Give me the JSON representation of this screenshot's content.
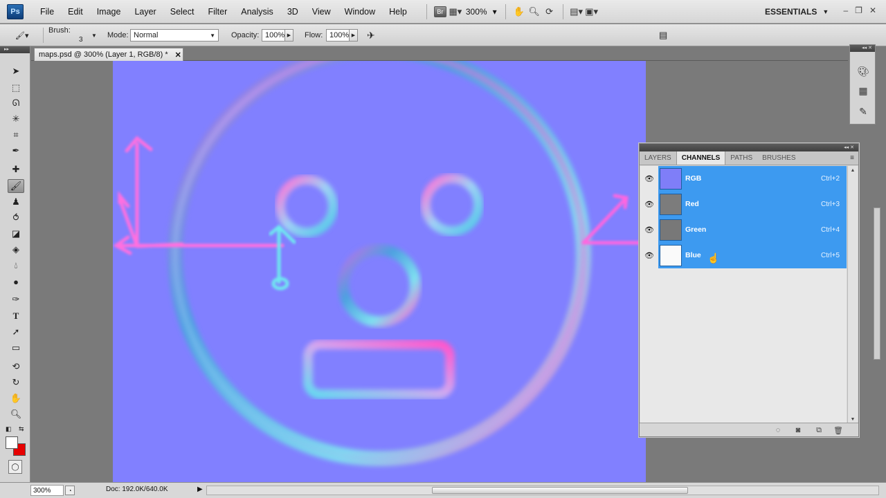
{
  "app": {
    "logo": "Ps"
  },
  "menu": [
    "File",
    "Edit",
    "Image",
    "Layer",
    "Select",
    "Filter",
    "Analysis",
    "3D",
    "View",
    "Window",
    "Help"
  ],
  "menubar_tools": {
    "bridge_label": "Br",
    "zoom_value": "300%"
  },
  "workspace_switcher": {
    "label": "ESSENTIALS"
  },
  "options": {
    "brush_label": "Brush:",
    "brush_size": "3",
    "mode_label": "Mode:",
    "mode_value": "Normal",
    "opacity_label": "Opacity:",
    "opacity_value": "100%",
    "flow_label": "Flow:",
    "flow_value": "100%"
  },
  "document": {
    "tab_title": "maps.psd @ 300% (Layer 1, RGB/8) *",
    "close_glyph": "✕"
  },
  "panel": {
    "tabs": [
      "LAYERS",
      "CHANNELS",
      "PATHS",
      "BRUSHES"
    ],
    "active_tab": "CHANNELS",
    "channels": [
      {
        "name": "RGB",
        "shortcut": "Ctrl+2",
        "thumb_color": "#7f7ef8"
      },
      {
        "name": "Red",
        "shortcut": "Ctrl+3",
        "thumb_color": "#7c7c7c"
      },
      {
        "name": "Green",
        "shortcut": "Ctrl+4",
        "thumb_color": "#787878"
      },
      {
        "name": "Blue",
        "shortcut": "Ctrl+5",
        "thumb_color": "#fafafa"
      }
    ]
  },
  "status": {
    "zoom": "300%",
    "doc_info": "Doc: 192.0K/640.0K"
  },
  "colors": {
    "canvas_bg": "#8180ff",
    "selection_blue": "#3d9af0",
    "foreground": "#ffffff",
    "background": "#e60000"
  }
}
